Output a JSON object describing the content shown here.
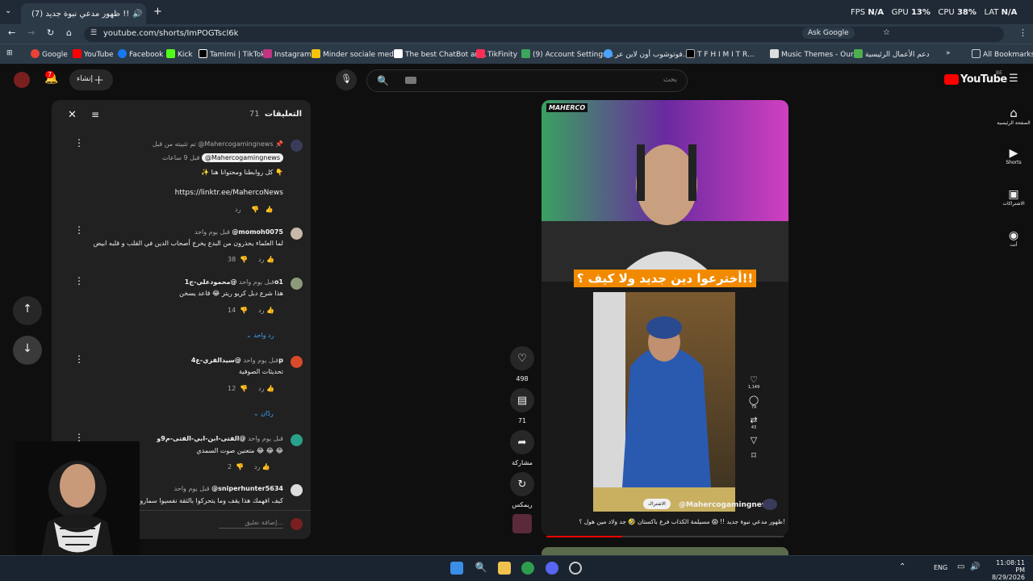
{
  "browser": {
    "tab_title": "(7) ظهور مدعي نبوة جديد !!",
    "url": "youtube.com/shorts/ImPOGTscl6k",
    "ask_google": "Ask Google",
    "perf": {
      "fps_label": "FPS",
      "fps": "N/A",
      "gpu_label": "GPU",
      "gpu": "13%",
      "cpu_label": "CPU",
      "cpu": "38%",
      "lat_label": "LAT",
      "lat": "N/A"
    },
    "bookmarks": [
      "Google",
      "YouTube",
      "Facebook",
      "Kick",
      "Tamimi | TikTok",
      "Instagram",
      "Minder sociale medi...",
      "The best ChatBot an...",
      "TikFinity",
      "(9) Account Settings...",
      "فوتوشوب أون لاين عر...",
      "T F H I M I T R...",
      "Music Themes - Our...",
      "دعم الأعمال الرئيسية"
    ],
    "all_bookmarks": "All Bookmarks"
  },
  "youtube": {
    "create_label": "إنشاء",
    "notif_count": "7",
    "search_placeholder": "بحث",
    "logo_text": "YouTube",
    "logo_region": "BE",
    "nav": [
      {
        "icon": "home-icon",
        "label": "الصفحة الرئيسية"
      },
      {
        "icon": "shorts-icon",
        "label": "Shorts"
      },
      {
        "icon": "subscriptions-icon",
        "label": "الاشتراكات"
      },
      {
        "icon": "you-icon",
        "label": "أنت"
      }
    ]
  },
  "comments": {
    "title": "التعليقات",
    "count": "71",
    "add_placeholder": "إضافة تعليق...",
    "items": [
      {
        "author": "Mahercogamingnews",
        "pinned": "تم تثبيته من قبل @Mahercogamingnews",
        "time": "قبل 9 ساعات",
        "badge": "@Mahercogamingnews",
        "text": "✨ كل روابطنا ومحتوانا هنا 👇",
        "link": "https://linktr.ee/MahercoNews",
        "likes": "",
        "reply": "رد"
      },
      {
        "author": "@momoh0075",
        "time": "قبل يوم واحد",
        "text": "لما العلماء يحذرون من البدع يخرج أصحاب الدين في القلب و قلبه ابيض",
        "likes": "38",
        "reply": "رد"
      },
      {
        "author": "@محمودعلي-ج1o1",
        "time": "قبل يوم واحد",
        "text": "هذا شرع دبل كريو ريتر 😂 قاعد يسخن",
        "likes": "14",
        "reply": "رد",
        "replies": "رد واحد"
      },
      {
        "author": "@سيدالقزي-ع4p",
        "time": "قبل يوم واحد",
        "text": "تحديثات الصوفية",
        "likes": "12",
        "reply": "رد",
        "replies": "ردّان"
      },
      {
        "author": "@الفتى-ابن-ابي-الفتى-م9و",
        "time": "قبل يوم واحد",
        "text": "متعنين صوت السمدي 😂 😂 😂",
        "likes": "2",
        "reply": "رد"
      },
      {
        "author": "@sniperhunter5634",
        "time": "قبل يوم واحد",
        "text": "كيف افهمك هذا يقف وما يتحركوا بالثقة نفسيوا سماروا يتحركوا",
        "likes": "",
        "reply": ""
      }
    ]
  },
  "video": {
    "brand": "MAHERCO",
    "overlay_text": "أخترعوا دين جديد ولا كيف ؟!!",
    "channel": "@Mahercogamingnews",
    "subscribe": "الاشتراك",
    "caption": "ظهور مدعي نبوة جديد !! 😱 مسيلمة الكذاب فرع باكستان 🤣 جد ولاد مين هول ؟!",
    "inner_counts": {
      "likes": "1,149",
      "comments": "79",
      "shares": "43"
    },
    "actions": {
      "likes": "498",
      "comments": "71",
      "share": "مشاركة",
      "remix": "ريمكس"
    }
  },
  "taskbar": {
    "lang": "ENG",
    "time": "11:08:11 PM",
    "date": "8/29/2026"
  },
  "colors": {
    "accent": "#3ea6ff",
    "yt_red": "#ff0000",
    "panel": "#212121"
  }
}
